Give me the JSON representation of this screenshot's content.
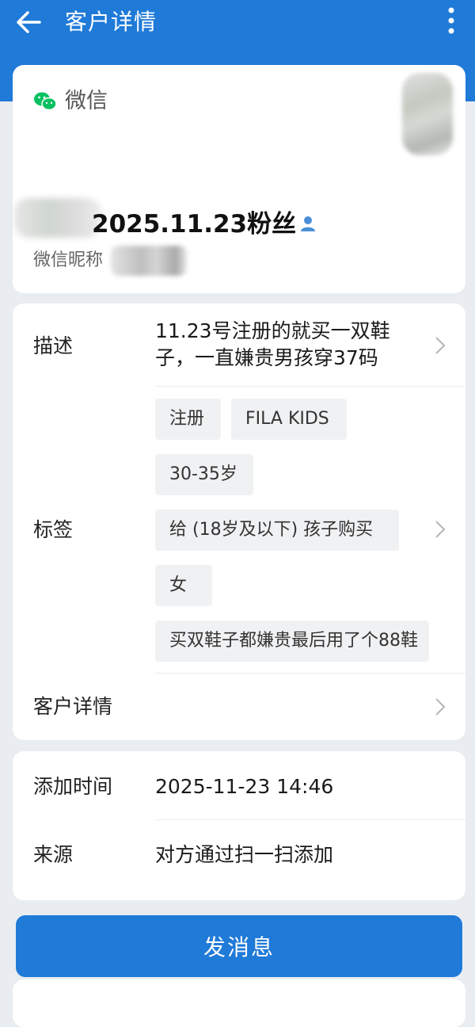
{
  "header": {
    "title": "客户详情",
    "back_icon": "arrow-left-icon",
    "more_icon": "more-vertical-icon"
  },
  "profile": {
    "platform_label": "微信",
    "platform_icon": "wechat-icon",
    "name": "2025.11.23粉丝",
    "person_icon": "person-icon",
    "nickname_label": "微信昵称"
  },
  "details": {
    "description": {
      "label": "描述",
      "value": "11.23号注册的就买一双鞋子，一直嫌贵男孩穿37码"
    },
    "tags": {
      "label": "标签",
      "items": [
        "注册",
        "FILA KIDS",
        "30-35岁",
        "给 (18岁及以下) 孩子购买",
        "女",
        "买双鞋子都嫌贵最后用了个88鞋"
      ]
    },
    "customer_details": {
      "label": "客户详情"
    }
  },
  "meta": {
    "add_time": {
      "label": "添加时间",
      "value": "2025-11-23 14:46"
    },
    "source": {
      "label": "来源",
      "value": "对方通过扫一扫添加"
    }
  },
  "actions": {
    "send_message_label": "发消息"
  },
  "colors": {
    "primary": "#1f7ad8",
    "wechat_green": "#07c160",
    "page_bg": "#e9edf2"
  }
}
